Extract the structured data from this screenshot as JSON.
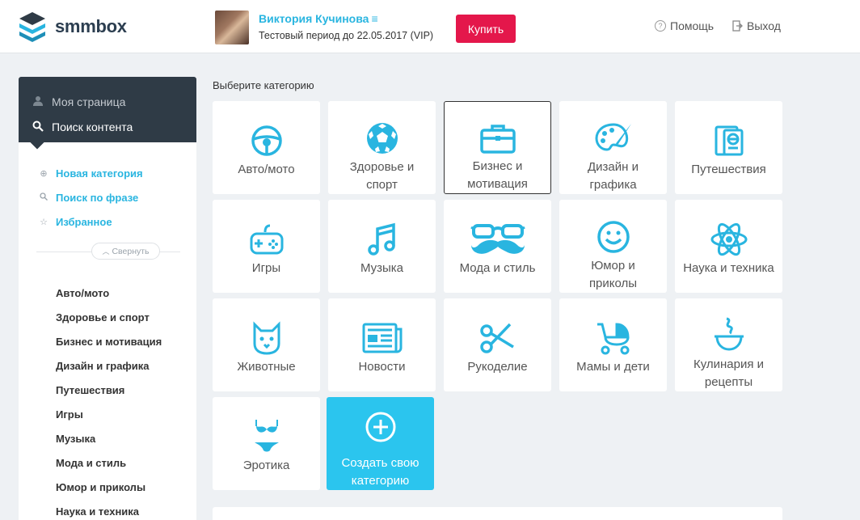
{
  "header": {
    "logo_text": "smmbox",
    "user_name": "Виктория Кучинова",
    "user_menu_icon": "≡",
    "trial_text": "Тестовый период до 22.05.2017 (VIP)",
    "buy_label": "Купить",
    "help_label": "Помощь",
    "logout_label": "Выход"
  },
  "sidebar": {
    "my_page": "Моя страница",
    "content_search": "Поиск контента",
    "links": [
      {
        "label": "Новая категория",
        "icon": "plus-circle-icon"
      },
      {
        "label": "Поиск по фразе",
        "icon": "search-icon"
      },
      {
        "label": "Избранное",
        "icon": "star-icon"
      }
    ],
    "collapse_label": "Свернуть",
    "categories": [
      "Авто/мото",
      "Здоровье и спорт",
      "Бизнес и мотивация",
      "Дизайн и графика",
      "Путешествия",
      "Игры",
      "Музыка",
      "Мода и стиль",
      "Юмор и приколы",
      "Наука и техника"
    ]
  },
  "main": {
    "title": "Выберите категорию",
    "tiles": [
      {
        "label": "Авто/мото",
        "icon": "steering-wheel-icon"
      },
      {
        "label": "Здоровье и спорт",
        "icon": "soccer-ball-icon"
      },
      {
        "label": "Бизнес и мотивация",
        "icon": "briefcase-icon",
        "selected": true
      },
      {
        "label": "Дизайн и графика",
        "icon": "palette-icon"
      },
      {
        "label": "Путешествия",
        "icon": "passport-icon"
      },
      {
        "label": "Игры",
        "icon": "gamepad-icon"
      },
      {
        "label": "Музыка",
        "icon": "music-note-icon"
      },
      {
        "label": "Мода и стиль",
        "icon": "glasses-mustache-icon"
      },
      {
        "label": "Юмор и приколы",
        "icon": "smiley-icon"
      },
      {
        "label": "Наука и техника",
        "icon": "atom-icon"
      },
      {
        "label": "Животные",
        "icon": "cat-icon"
      },
      {
        "label": "Новости",
        "icon": "newspaper-icon"
      },
      {
        "label": "Рукоделие",
        "icon": "scissors-icon"
      },
      {
        "label": "Мамы и дети",
        "icon": "stroller-icon"
      },
      {
        "label": "Кулинария и рецепты",
        "icon": "bowl-icon"
      },
      {
        "label": "Эротика",
        "icon": "bikini-icon"
      }
    ],
    "create_tile": {
      "label": "Создать свою категорию",
      "icon": "plus-circle-icon"
    }
  },
  "colors": {
    "accent": "#29b5e0",
    "buy": "#e4174b",
    "sidebar_dark": "#2f3b46",
    "create_tile": "#2bc5ee"
  }
}
